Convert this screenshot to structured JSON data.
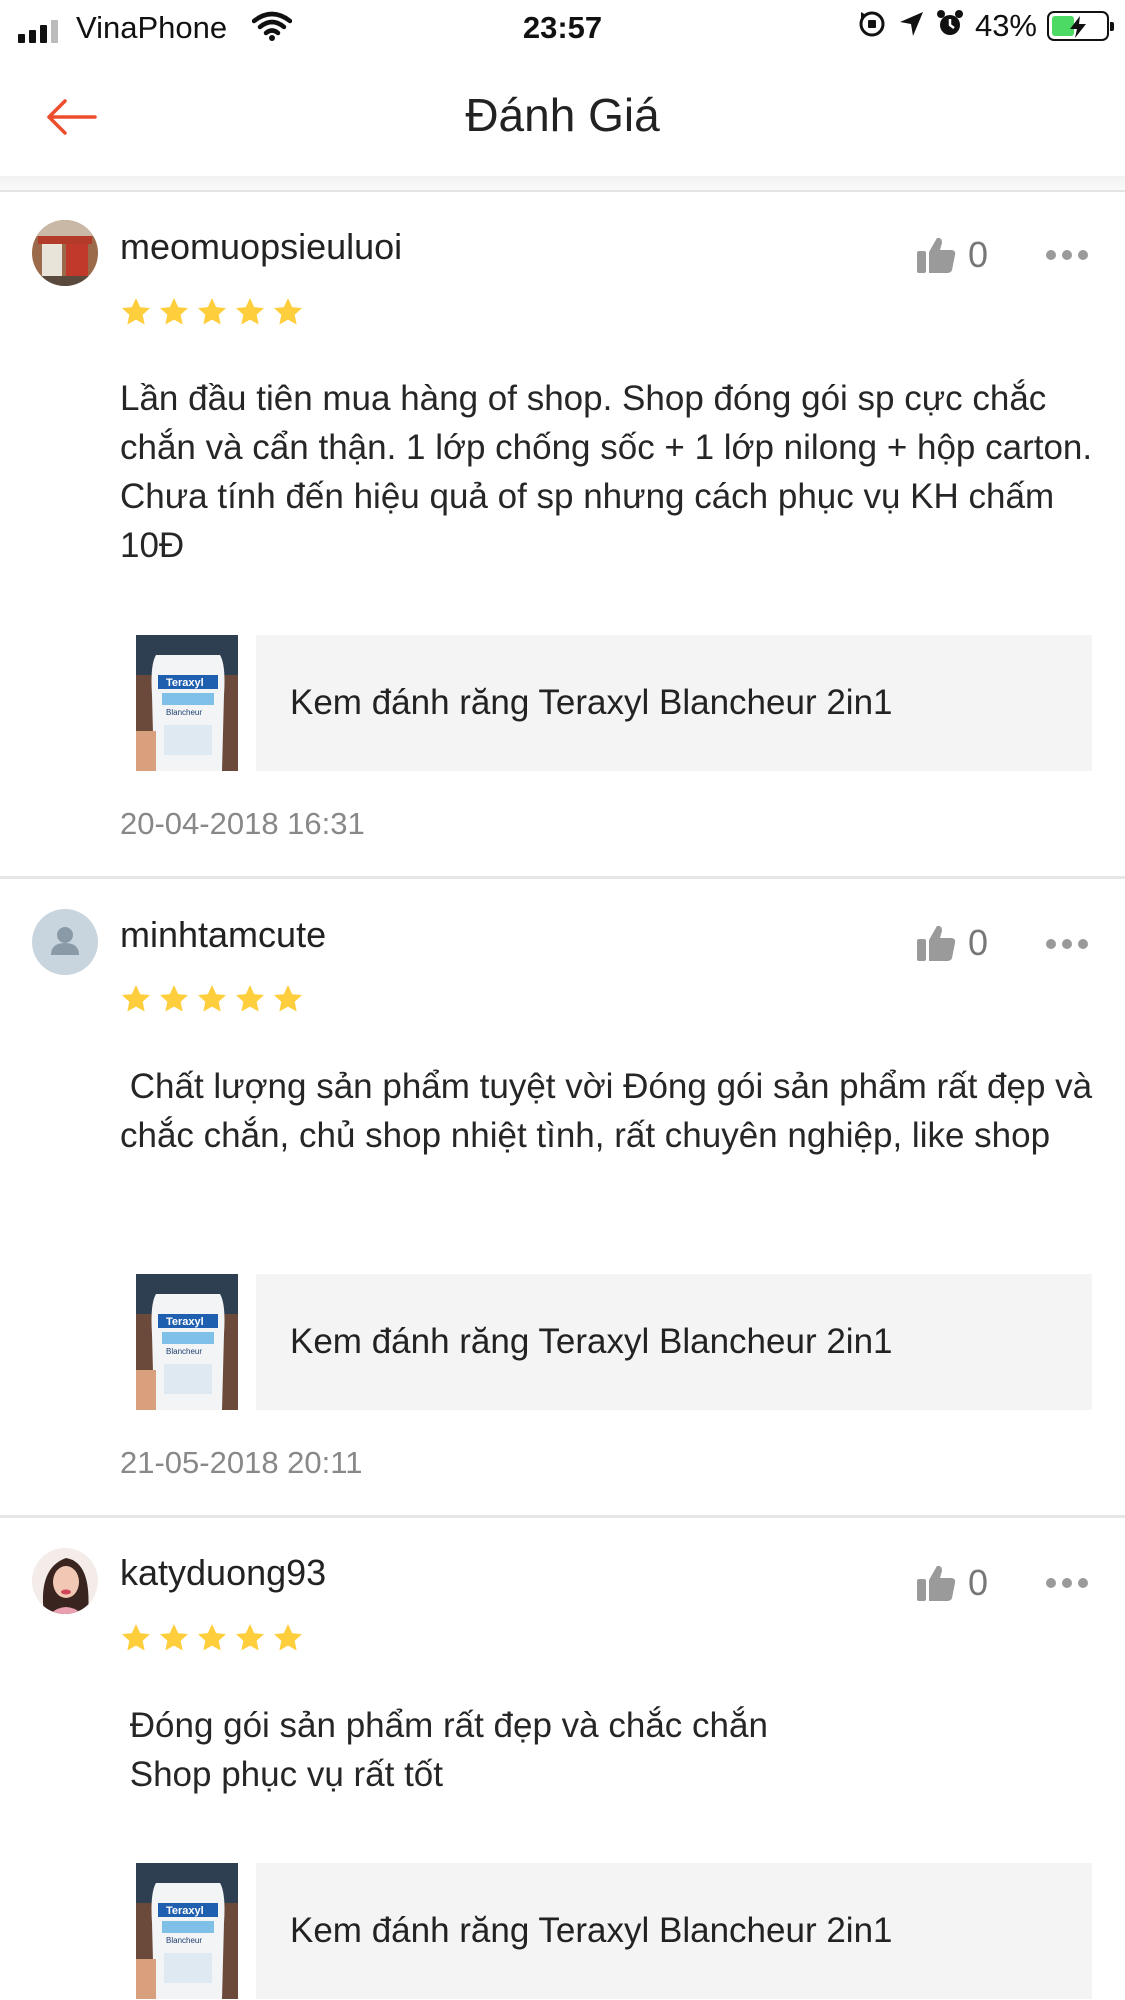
{
  "status_bar": {
    "carrier": "VinaPhone",
    "time": "23:57",
    "battery_percent": "43%",
    "battery_level": 0.43,
    "icons": [
      "signal-icon",
      "wifi-icon",
      "orientation-lock-icon",
      "location-icon",
      "alarm-icon",
      "battery-charging-icon"
    ]
  },
  "header": {
    "title": "Đánh Giá",
    "back_icon": "arrow-left-icon",
    "accent_color": "#ee4d2d"
  },
  "colors": {
    "star": "#ffce3d",
    "date": "#888888",
    "divider": "#e6e6e6",
    "product_card_bg": "#f4f4f4"
  },
  "reviews": [
    {
      "username": "meomuopsieuluoi",
      "avatar": "storefront-photo",
      "rating": 5,
      "likes": "0",
      "text": "Lần đầu tiên mua hàng of shop. Shop đóng gói sp cực chắc chắn và cẩn thận. 1 lớp chống sốc + 1 lớp nilong + hộp carton. Chưa tính đến hiệu quả of sp nhưng cách phục vụ KH chấm 10Đ",
      "product": {
        "name": "Kem đánh răng Teraxyl Blancheur 2in1",
        "thumb_brand": "Teraxyl",
        "thumb_variant": "Blancheur"
      },
      "date": "20-04-2018 16:31"
    },
    {
      "username": "minhtamcute",
      "avatar": "default-user-icon",
      "rating": 5,
      "likes": "0",
      "text": " Chất lượng sản phẩm tuyệt vời Đóng gói sản phẩm rất đẹp và chắc chắn, chủ shop nhiệt tình, rất chuyên nghiệp, like shop",
      "product": {
        "name": "Kem đánh răng Teraxyl Blancheur 2in1",
        "thumb_brand": "Teraxyl",
        "thumb_variant": "Blancheur"
      },
      "date": "21-05-2018 20:11"
    },
    {
      "username": "katyduong93",
      "avatar": "portrait-photo",
      "rating": 5,
      "likes": "0",
      "text": " Đóng gói sản phẩm rất đẹp và chắc chắn\n Shop phục vụ rất tốt",
      "product": {
        "name": "Kem đánh răng Teraxyl Blancheur 2in1",
        "thumb_brand": "Teraxyl",
        "thumb_variant": "Blancheur"
      },
      "date": ""
    }
  ]
}
